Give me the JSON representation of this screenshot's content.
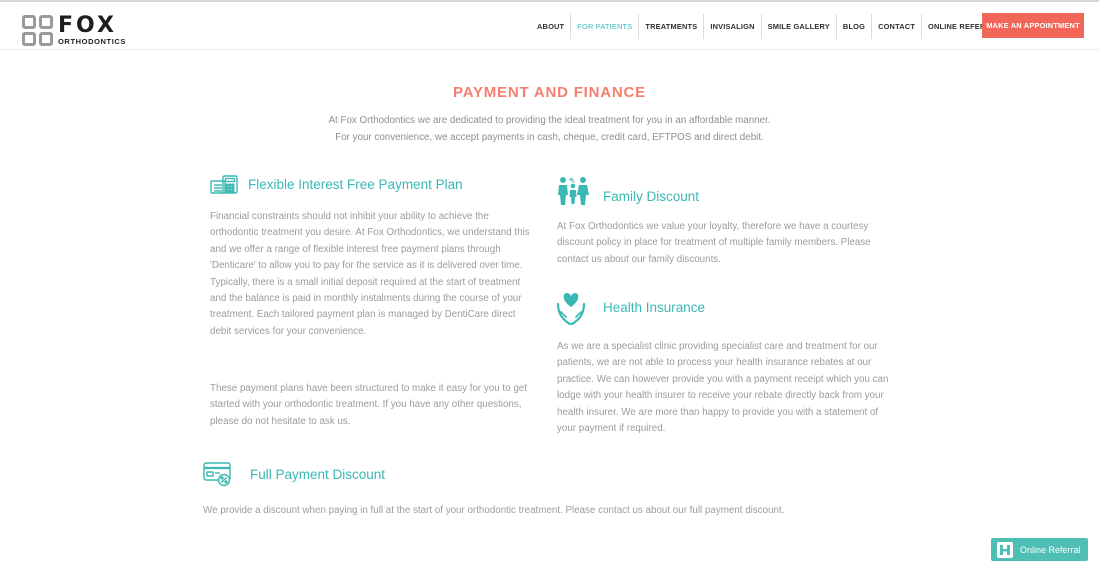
{
  "brand": {
    "name": "FOX",
    "subtitle": "ORTHODONTICS",
    "logo_colors": [
      "#e5392f",
      "#f2a22a",
      "#4a90d9",
      "#2fb39a"
    ]
  },
  "nav": {
    "items": [
      {
        "label": "ABOUT"
      },
      {
        "label": "FOR PATIENTS",
        "active": true
      },
      {
        "label": "TREATMENTS"
      },
      {
        "label": "INVISALIGN"
      },
      {
        "label": "SMILE GALLERY"
      },
      {
        "label": "BLOG"
      },
      {
        "label": "CONTACT"
      },
      {
        "label": "ONLINE REFERRALS"
      }
    ],
    "cta_label": "MAKE AN APPOINTMENT"
  },
  "page": {
    "title": "PAYMENT AND FINANCE",
    "intro_line1": "At Fox Orthodontics we are dedicated to providing the ideal treatment for you in an affordable manner.",
    "intro_line2": "For your convenience, we accept payments in cash, cheque, credit card, EFTPOS and direct debit."
  },
  "sections": {
    "flexible": {
      "icon": "calculator-money-icon",
      "title": "Flexible Interest Free Payment Plan",
      "body1": "Financial constraints should not inhibit your ability to achieve the orthodontic treatment you desire. At Fox Orthodontics, we understand this and we offer a range of flexible interest free payment plans through 'Denticare' to allow you to pay for the service as it is delivered over time. Typically, there is a small initial deposit required at the start of treatment and the balance is paid in monthly instalments during the course of your treatment. Each tailored payment plan is managed by DentiCare direct debit services for your convenience.",
      "body2": "These payment plans have been structured to make it easy for you to get started with your orthodontic treatment. If you have any other questions, please do not hesitate to ask us."
    },
    "family": {
      "icon": "family-icon",
      "title": "Family Discount",
      "body": "At Fox Orthodontics we value your loyalty, therefore we have a courtesy discount policy in place for treatment of multiple family members. Please contact us about our family discounts."
    },
    "health": {
      "icon": "heart-hands-icon",
      "title": "Health Insurance",
      "body": "As we are a specialist clinic providing specialist care and treatment for our patients, we are not able to process your health insurance rebates at our practice. We can however provide you with a payment receipt which you can lodge with your health insurer to receive your rebate directly back from your health insurer. We are more than happy to provide you with a statement of your payment if required."
    },
    "full": {
      "icon": "card-discount-icon",
      "title": "Full Payment Discount",
      "body": "We provide a discount when paying in full at the start of your orthodontic treatment. Please contact us about our full payment discount."
    }
  },
  "widget": {
    "label": "Online Referral",
    "icon": "referral-h-icon"
  },
  "colors": {
    "accent_teal": "#3ab8b4",
    "accent_coral": "#f47f6e",
    "cta_bg": "#f2665a",
    "widget_bg": "#4fbfb5"
  }
}
